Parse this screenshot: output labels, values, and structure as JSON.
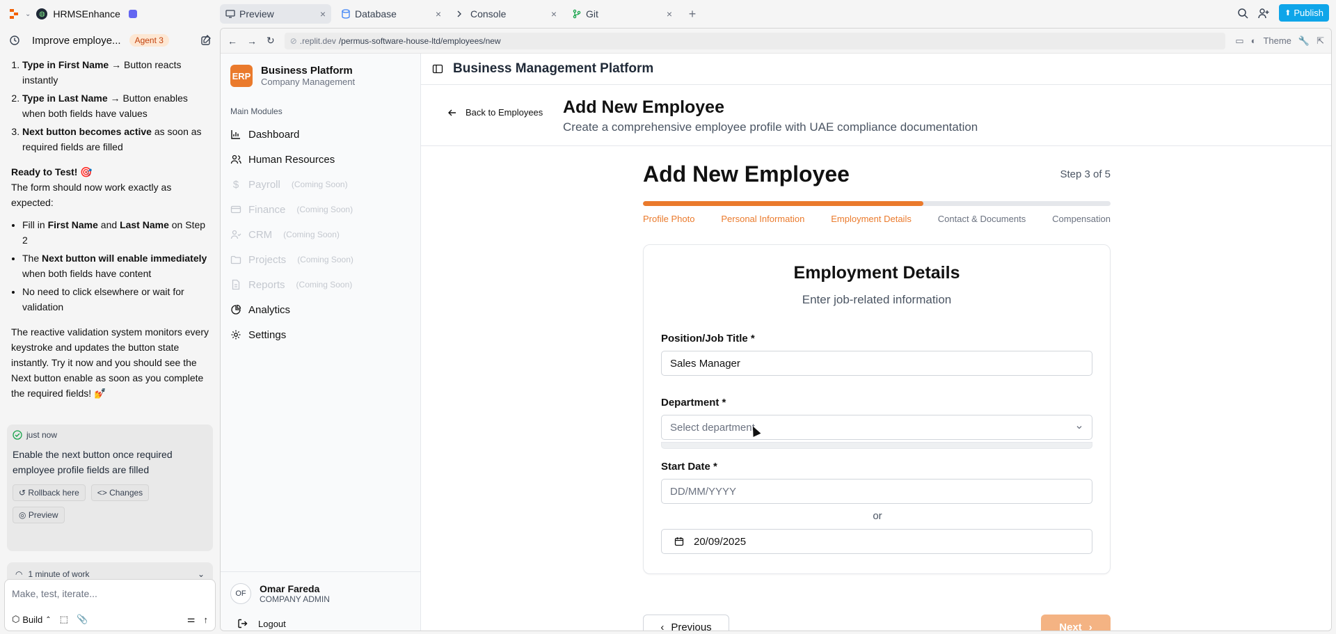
{
  "topbar": {
    "project_name": "HRMSEnhance",
    "tabs": [
      {
        "label": "Preview",
        "icon": "monitor-icon"
      },
      {
        "label": "Database",
        "icon": "database-icon"
      },
      {
        "label": "Console",
        "icon": "terminal-icon"
      },
      {
        "label": "Git",
        "icon": "git-icon"
      }
    ],
    "publish_label": "Publish"
  },
  "agent": {
    "header_title": "Improve employe...",
    "badge": "Agent 3",
    "steps": [
      {
        "bold": "Type in First Name",
        "rest": " → Button reacts instantly"
      },
      {
        "bold": "Type in Last Name",
        "rest": " → Button enables when both fields have values"
      },
      {
        "bold": "Next button becomes active",
        "rest": " as soon as required fields are filled"
      }
    ],
    "ready_bold": "Ready to Test!",
    "ready_emoji": "🎯",
    "ready_text": "The form should now work exactly as expected:",
    "bullets": [
      {
        "pre": "Fill in ",
        "b1": "First Name",
        "mid": " and ",
        "b2": "Last Name",
        "post": " on Step 2"
      },
      {
        "pre": "The ",
        "b1": "Next button will enable immediately",
        "mid": " when both fields have content",
        "b2": "",
        "post": ""
      },
      {
        "pre": "No need to click elsewhere or wait for validation",
        "b1": "",
        "mid": "",
        "b2": "",
        "post": ""
      }
    ],
    "closing": "The reactive validation system monitors every keystroke and updates the button state instantly. Try it now and you should see the Next button enable as soon as you complete the required fields! 💅",
    "card": {
      "timestamp": "just now",
      "summary": "Enable the next button once required employee profile fields are filled",
      "rollback_label": "Rollback here",
      "changes_label": "Changes",
      "preview_label": "Preview"
    },
    "work_time": "1 minute of work",
    "composer_placeholder": "Make, test, iterate...",
    "build_label": "Build"
  },
  "browser": {
    "url_prefix": ".replit.dev",
    "url_path": "/permus-software-house-ltd/employees/new",
    "theme_label": "Theme"
  },
  "app": {
    "brand_logo": "ERP",
    "brand_name": "Business Platform",
    "brand_sub": "Company Management",
    "section_label": "Main Modules",
    "nav": [
      {
        "label": "Dashboard",
        "soon": "",
        "icon": "bar-chart-icon",
        "disabled": false
      },
      {
        "label": "Human Resources",
        "soon": "",
        "icon": "users-icon",
        "disabled": false
      },
      {
        "label": "Payroll",
        "soon": "(Coming Soon)",
        "icon": "dollar-icon",
        "disabled": true
      },
      {
        "label": "Finance",
        "soon": "(Coming Soon)",
        "icon": "credit-card-icon",
        "disabled": true
      },
      {
        "label": "CRM",
        "soon": "(Coming Soon)",
        "icon": "user-check-icon",
        "disabled": true
      },
      {
        "label": "Projects",
        "soon": "(Coming Soon)",
        "icon": "folder-icon",
        "disabled": true
      },
      {
        "label": "Reports",
        "soon": "(Coming Soon)",
        "icon": "file-text-icon",
        "disabled": true
      },
      {
        "label": "Analytics",
        "soon": "",
        "icon": "pie-chart-icon",
        "disabled": false
      },
      {
        "label": "Settings",
        "soon": "",
        "icon": "gear-icon",
        "disabled": false
      }
    ],
    "user_initials": "OF",
    "user_name": "Omar Fareda",
    "user_role": "COMPANY ADMIN",
    "logout_label": "Logout",
    "header_title": "Business Management Platform"
  },
  "page": {
    "back_label": "Back to Employees",
    "title": "Add New Employee",
    "subtitle": "Create a comprehensive employee profile with UAE compliance documentation"
  },
  "wizard": {
    "title": "Add New Employee",
    "step_text": "Step 3 of 5",
    "progress_fraction": 0.6,
    "steps": [
      {
        "label": "Profile Photo",
        "done": true
      },
      {
        "label": "Personal Information",
        "done": true
      },
      {
        "label": "Employment Details",
        "done": true
      },
      {
        "label": "Contact & Documents",
        "done": false
      },
      {
        "label": "Compensation",
        "done": false
      }
    ],
    "card_title": "Employment Details",
    "card_sub": "Enter job-related information",
    "position_label": "Position/Job Title *",
    "position_value": "Sales Manager",
    "department_label": "Department *",
    "department_placeholder": "Select department",
    "start_date_label": "Start Date *",
    "start_date_placeholder": "DD/MM/YYYY",
    "or_text": "or",
    "picked_date": "20/09/2025",
    "prev_label": "Previous",
    "next_label": "Next"
  },
  "colors": {
    "accent": "#ea7a2c",
    "publish": "#0ea5e9"
  }
}
